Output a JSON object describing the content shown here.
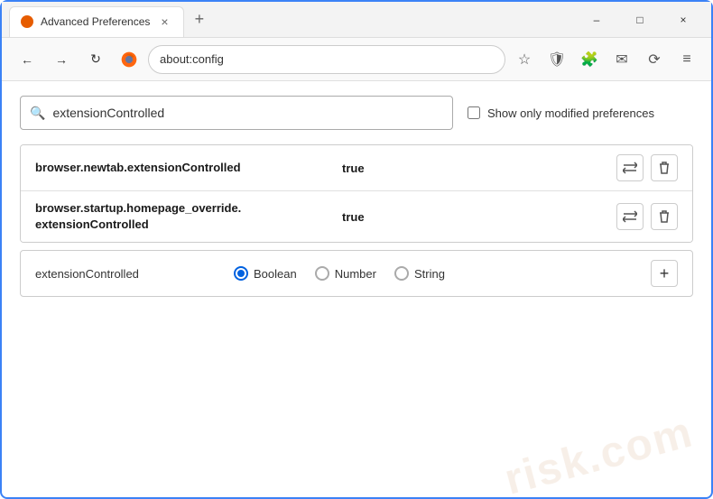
{
  "window": {
    "title": "Advanced Preferences",
    "tab_close": "×",
    "new_tab": "+",
    "minimize": "–",
    "maximize": "□",
    "close": "×"
  },
  "nav": {
    "back": "←",
    "forward": "→",
    "refresh": "↻",
    "browser_name": "Firefox",
    "address": "about:config",
    "bookmark_icon": "☆",
    "shield_icon": "🛡",
    "ext_icon": "🧩",
    "mail_icon": "✉",
    "sync_icon": "⟳",
    "menu_icon": "≡"
  },
  "search": {
    "placeholder": "extensionControlled",
    "value": "extensionControlled",
    "show_modified_label": "Show only modified preferences"
  },
  "preferences": [
    {
      "name": "browser.newtab.extensionControlled",
      "value": "true"
    },
    {
      "name": "browser.startup.homepage_override.\nextensionControlled",
      "name_line1": "browser.startup.homepage_override.",
      "name_line2": "extensionControlled",
      "value": "true"
    }
  ],
  "new_pref": {
    "name": "extensionControlled",
    "type_options": [
      "Boolean",
      "Number",
      "String"
    ],
    "selected_type": "Boolean",
    "add_label": "+"
  },
  "colors": {
    "accent": "#0061e0",
    "border": "#3b82f6"
  }
}
